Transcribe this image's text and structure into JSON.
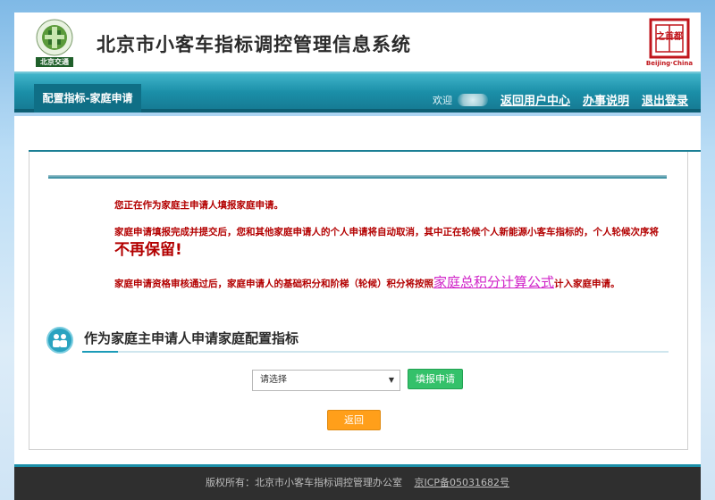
{
  "header": {
    "title": "北京市小客车指标调控管理信息系统",
    "logo_text": "北京交通",
    "seal_text": "之首都",
    "seal_sub": "Beijing·China"
  },
  "navbar": {
    "tab_label": "配置指标-家庭申请",
    "welcome": "欢迎",
    "links": [
      "返回用户中心",
      "办事说明",
      "退出登录"
    ]
  },
  "notice": {
    "line1": "您正在作为家庭主申请人填报家庭申请。",
    "line2_pre": "家庭申请填报完成并提交后，您和其他家庭申请人的个人申请将自动取消，其中正在轮候个人新能源小客车指标的，个人轮候次序将",
    "line2_big": "不再保留!",
    "line3_pre": "家庭申请资格审核通过后，家庭申请人的基础积分和阶梯（轮候）积分将按照",
    "line3_link": "家庭总积分计算公式",
    "line3_post": "计入家庭申请。"
  },
  "section": {
    "title": "作为家庭主申请人申请家庭配置指标"
  },
  "form": {
    "select_value": "请选择",
    "apply_button": "填报申请",
    "back_button": "返回"
  },
  "footer": {
    "copyright": "版权所有：北京市小客车指标调控管理办公室",
    "icp": "京ICP备05031682号"
  },
  "colors": {
    "nav_teal": "#1b8fa8",
    "notice_red": "#b30000",
    "link_pink": "#d021c8",
    "apply_green": "#34c16a",
    "back_orange": "#ff9f1a"
  }
}
